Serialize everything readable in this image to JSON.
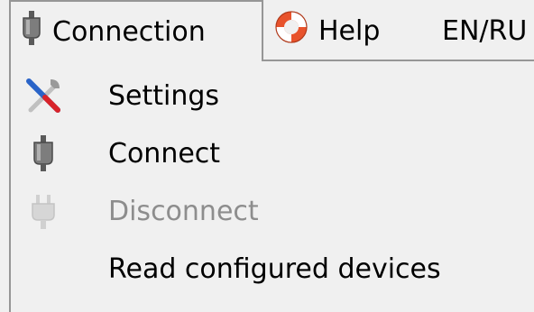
{
  "menubar": {
    "items": [
      {
        "label": "Connection",
        "icon": "plug-icon",
        "state": "open"
      },
      {
        "label": "Help",
        "icon": "lifebuoy-icon"
      },
      {
        "label": "EN/RU"
      }
    ]
  },
  "dropdown": {
    "items": [
      {
        "label": "Settings",
        "icon": "tools-icon",
        "enabled": true
      },
      {
        "label": "Connect",
        "icon": "plug-icon",
        "enabled": true
      },
      {
        "label": "Disconnect",
        "icon": "unplug-icon",
        "enabled": false
      },
      {
        "label": "Read configured devices",
        "enabled": true
      }
    ]
  },
  "colors": {
    "background": "#f0f0f0",
    "border": "#969696",
    "disabled_text": "#8d8d8d",
    "lifebuoy": "#e8532c"
  }
}
